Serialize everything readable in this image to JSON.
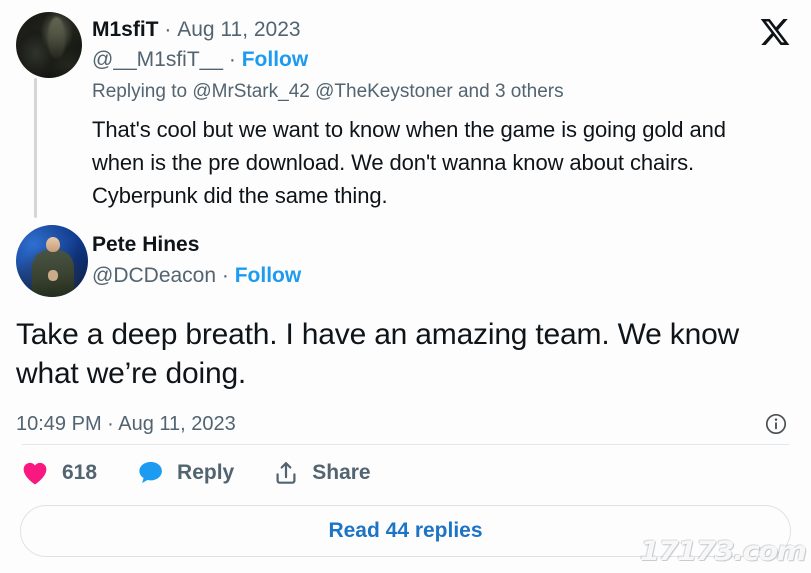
{
  "brand": {
    "logo_name": "x-logo",
    "accent_blue": "#1d9bf0",
    "link_blue": "#1d74c7",
    "like_pink": "#f91880",
    "text_primary": "#0f1419",
    "text_secondary": "#536471"
  },
  "parent_tweet": {
    "display_name": "M1sfiT",
    "separator": "·",
    "date": "Aug 11, 2023",
    "handle": "@__M1sfiT__",
    "follow_label": "Follow",
    "replying_to_prefix": "Replying to",
    "replying_to_mentions": "@MrStark_42 @TheKeystoner and 3 others",
    "body": "That's cool but we want to know when the game is going gold and when is the pre download. We don't wanna know about chairs. Cyberpunk did the same thing.",
    "avatar_name": "avatar-m1sfit"
  },
  "main_tweet": {
    "display_name": "Pete Hines",
    "handle": "@DCDeacon",
    "separator": "·",
    "follow_label": "Follow",
    "body": "Take a deep breath. I have an amazing team. We know what we’re doing.",
    "timestamp": "10:49 PM · Aug 11, 2023",
    "avatar_name": "avatar-pete-hines",
    "info_icon_name": "info-circle-icon"
  },
  "actions": {
    "like": {
      "icon": "heart-icon",
      "count": "618"
    },
    "reply": {
      "icon": "speech-bubble-icon",
      "label": "Reply"
    },
    "share": {
      "icon": "share-upload-icon",
      "label": "Share"
    }
  },
  "read_replies": {
    "label": "Read 44 replies"
  },
  "watermark": {
    "text": "17173.com"
  }
}
